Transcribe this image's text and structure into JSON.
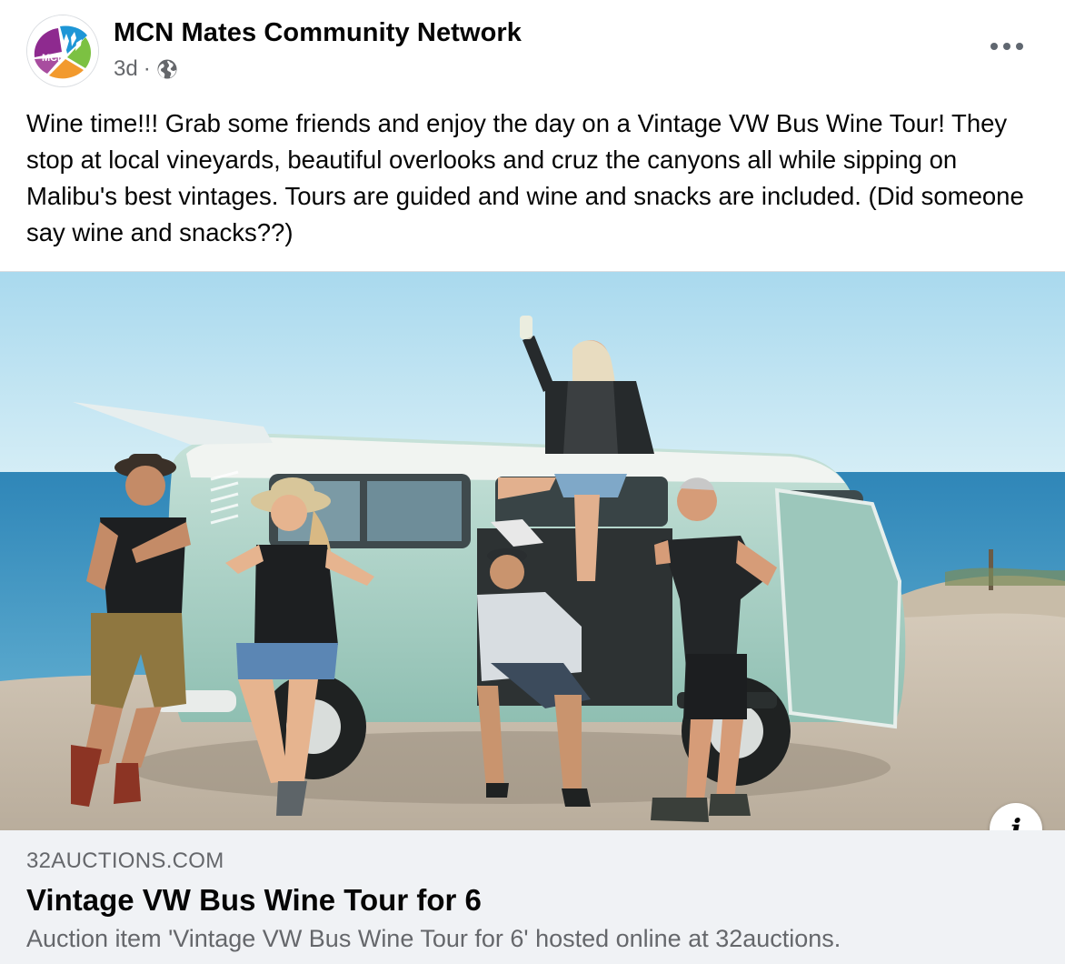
{
  "post": {
    "page_name": "MCN Mates Community Network",
    "avatar_text": "MCN",
    "time": "3d",
    "separator": "·",
    "privacy_icon": "globe-icon",
    "more_icon": "more-horizontal-icon",
    "text": "Wine time!!!  Grab some friends and enjoy the day on a Vintage VW Bus Wine Tour! They stop at local vineyards, beautiful overlooks and cruz the canyons all while sipping on Malibu's best vintages. Tours are guided and wine and snacks are included.  (Did someone say wine and snacks??)"
  },
  "photo": {
    "subject": "vintage-vw-bus-photo"
  },
  "link_preview": {
    "domain": "32AUCTIONS.COM",
    "title": "Vintage VW Bus Wine Tour for 6",
    "description": "Auction item 'Vintage VW Bus Wine Tour for 6' hosted online at 32auctions.",
    "info_icon": "info-icon",
    "info_label": "i"
  },
  "colors": {
    "primary_text": "#050505",
    "secondary_text": "#65676b",
    "preview_bg": "#f0f2f5",
    "bus_color": "#a9cfc4",
    "sky": "#bfe3f2",
    "sea": "#3f8fbf"
  }
}
